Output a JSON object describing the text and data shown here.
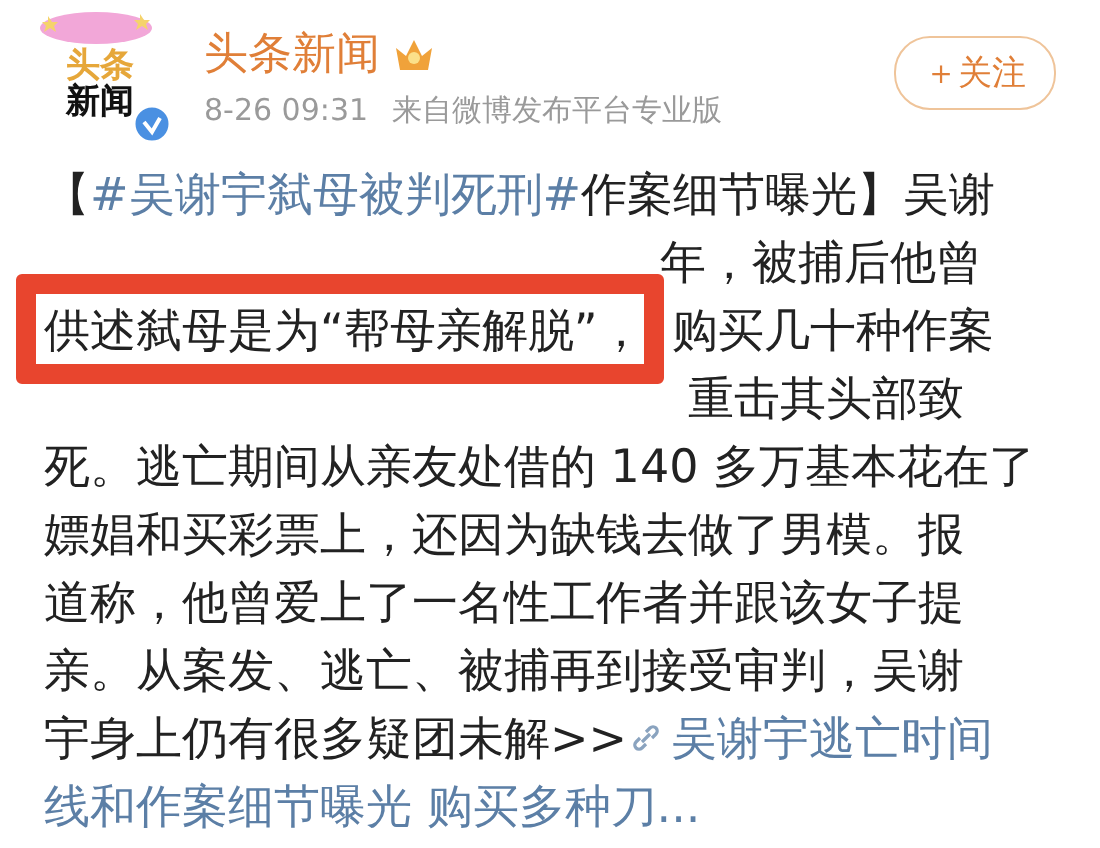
{
  "account": {
    "avatar_lines": [
      "头条",
      "新闻"
    ],
    "verified": true,
    "name": "头条新闻",
    "time": "8-26 09:31",
    "source": "来自微博发布平台专业版",
    "follow_button": "＋关注"
  },
  "post": {
    "lines": [
      [
        {
          "kind": "plain",
          "text": "【 "
        },
        {
          "kind": "hashtag",
          "text": "#吴谢宇弑母被判死刑#"
        },
        {
          "kind": "plain",
          "text": " 作案细节曝光】吴谢"
        }
      ],
      [
        {
          "kind": "covered"
        },
        {
          "kind": "plain",
          "text": "年，被捕后他曾"
        }
      ],
      [
        {
          "kind": "highlighted",
          "text": "供述弑母是为“帮母亲解脱”，"
        },
        {
          "kind": "plain",
          "text": "购买几十种作案"
        }
      ],
      [
        {
          "kind": "covered"
        },
        {
          "kind": "plain",
          "text": "重击其头部致"
        }
      ],
      [
        {
          "kind": "plain",
          "text": "死。逃亡期间从亲友处借的 140 多万基本花在了"
        }
      ],
      [
        {
          "kind": "plain",
          "text": "嫖娼和买彩票上，还因为缺钱去做了男模。报"
        }
      ],
      [
        {
          "kind": "plain",
          "text": "道称，他曾爱上了一名性工作者并跟该女子提"
        }
      ],
      [
        {
          "kind": "plain",
          "text": "亲。从案发、逃亡、被捕再到接受审判，吴谢"
        }
      ],
      [
        {
          "kind": "plain",
          "text": "宇身上仍有很多疑团未解>>"
        },
        {
          "kind": "link",
          "icon": true,
          "text": "吴谢宇逃亡时间"
        }
      ],
      [
        {
          "kind": "link",
          "icon": false,
          "text": "线和作案细节曝光 购买多种刀..."
        }
      ]
    ]
  }
}
